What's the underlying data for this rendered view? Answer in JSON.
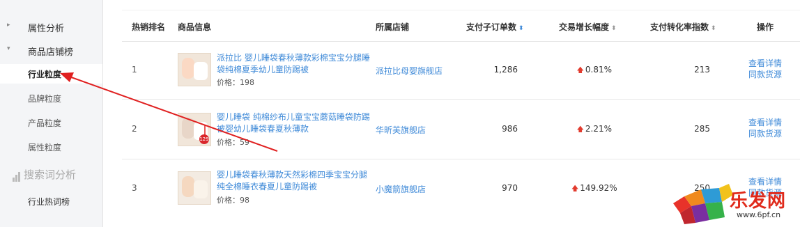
{
  "sidebar": {
    "items": [
      {
        "label": "属性分析",
        "arrow": "▸"
      },
      {
        "label": "商品店铺榜",
        "arrow": "▾"
      },
      {
        "label": "行业粒度"
      },
      {
        "label": "品牌粒度"
      },
      {
        "label": "产品粒度"
      },
      {
        "label": "属性粒度"
      }
    ],
    "search_title": "搜索词分析",
    "search_items": [
      {
        "label": "行业热词榜"
      }
    ]
  },
  "table": {
    "headers": {
      "rank": "热销排名",
      "product": "商品信息",
      "shop": "所属店铺",
      "orders": "支付子订单数",
      "growth": "交易增长幅度",
      "conversion": "支付转化率指数",
      "action": "操作"
    },
    "sort_icons": {
      "orders": "⬍",
      "growth": "⬍",
      "conversion": "⬍"
    },
    "rows": [
      {
        "rank": "1",
        "name": "派拉比 婴儿睡袋春秋薄款彩棉宝宝分腿睡袋纯棉夏季幼儿童防踢被",
        "price": "价格：198",
        "shop": "派拉比母婴旗舰店",
        "orders": "1,286",
        "growth": "0.81%",
        "conversion": "213",
        "action1": "查看详情",
        "action2": "同款货源"
      },
      {
        "rank": "2",
        "name": "婴儿睡袋 纯棉纱布儿童宝宝蘑菇睡袋防踢被婴幼儿睡袋春夏秋薄款",
        "price": "价格：59",
        "shop": "华昕芙旗舰店",
        "orders": "986",
        "growth": "2.21%",
        "conversion": "285",
        "action1": "查看详情",
        "action2": "同款货源"
      },
      {
        "rank": "3",
        "name": "婴儿睡袋春秋薄款天然彩棉四季宝宝分腿纯全棉睡衣春夏儿童防踢被",
        "price": "价格：98",
        "shop": "小魔箭旗舰店",
        "orders": "970",
        "growth": "149.92%",
        "conversion": "250",
        "action1": "查看详情",
        "action2": "同款货源"
      }
    ],
    "up_icon": "🡅"
  },
  "watermark": {
    "text": "乐发网",
    "url": "www.6pf.cn"
  },
  "colors": {
    "link": "#3f8ad8",
    "annotation": "#e02020",
    "up": "#e23b2e"
  }
}
